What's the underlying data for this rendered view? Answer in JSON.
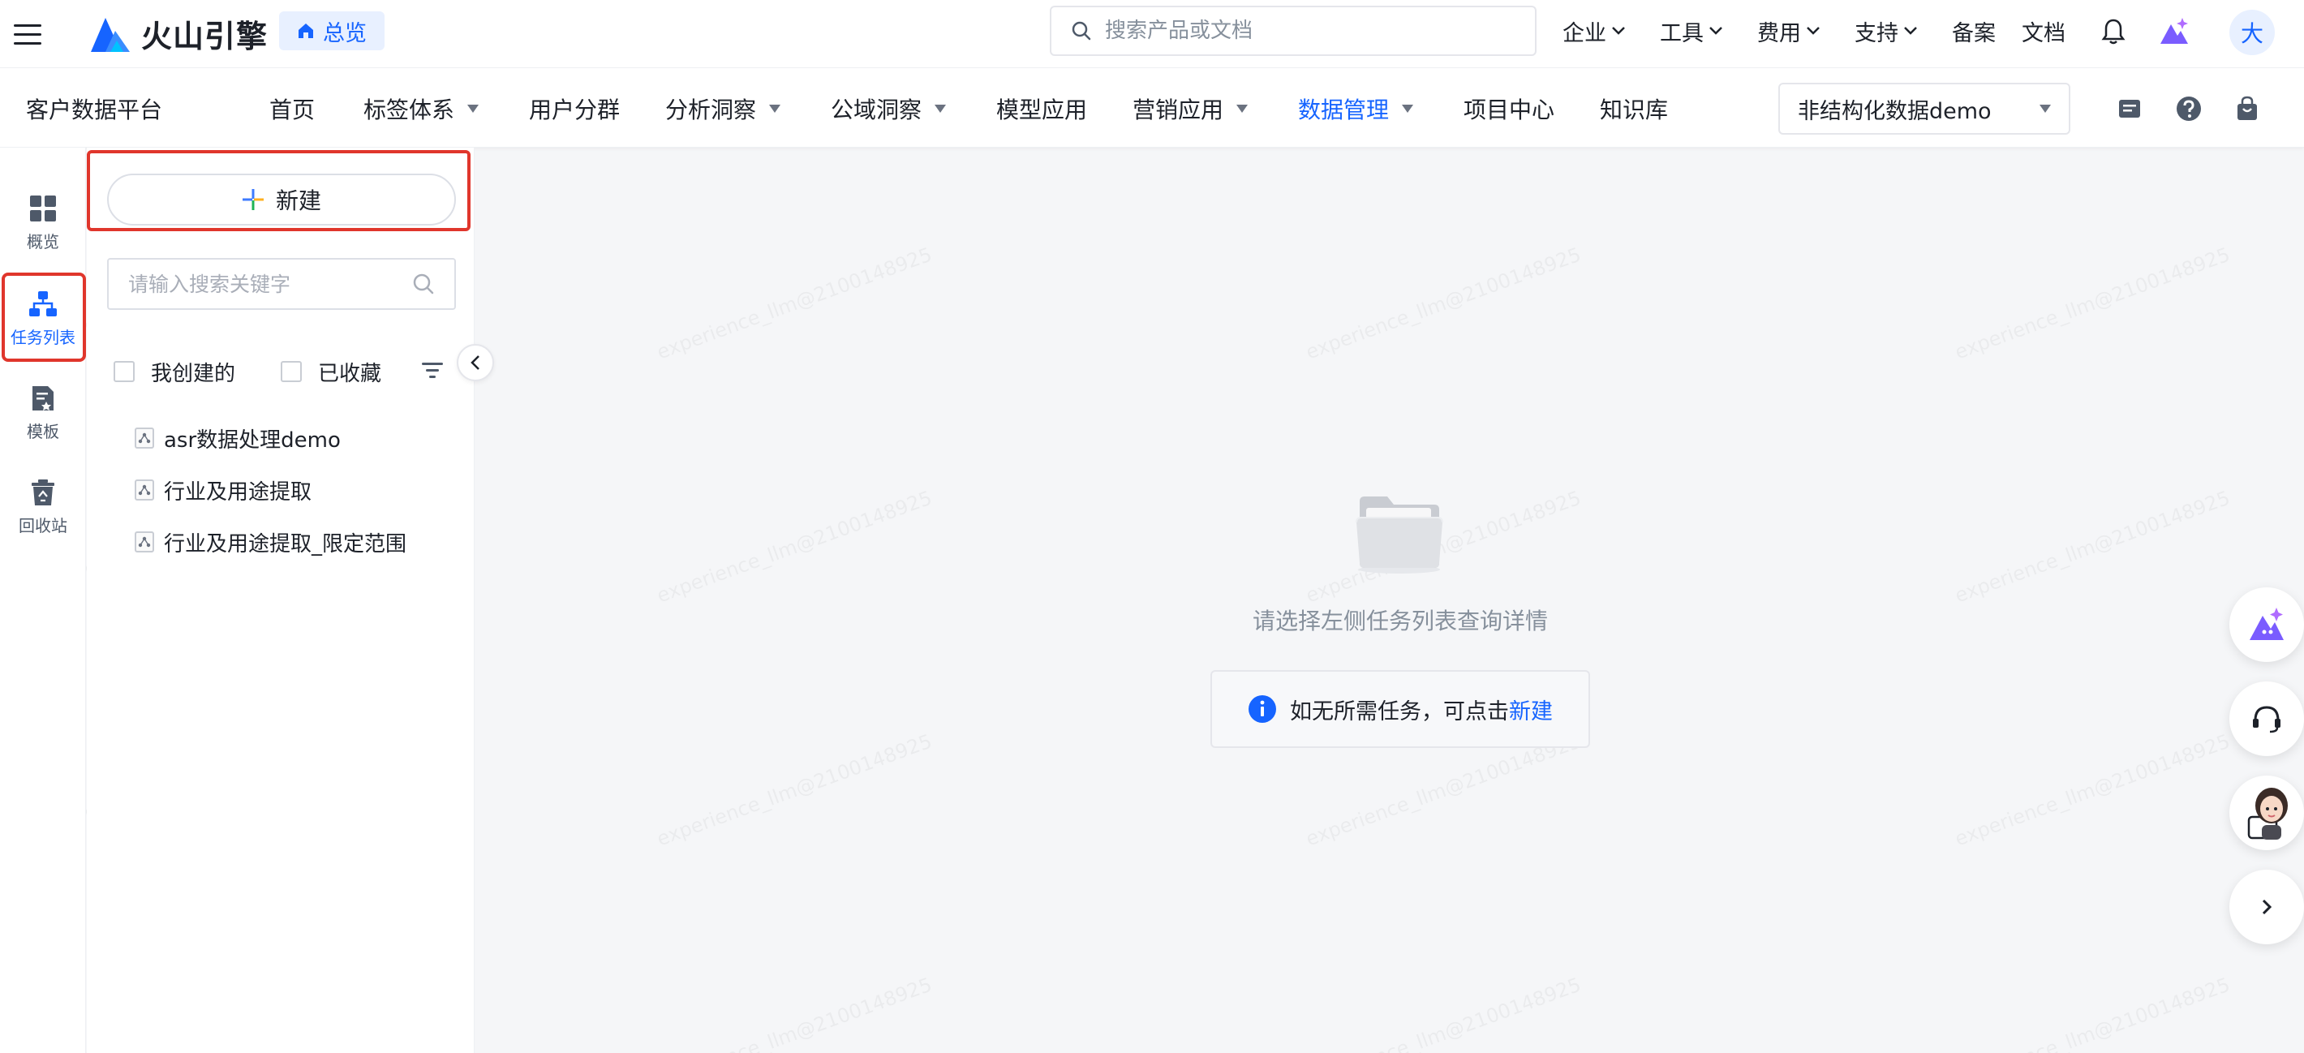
{
  "topbar": {
    "brand": "火山引擎",
    "overview_label": "总览",
    "search_placeholder": "搜索产品或文档",
    "menus": [
      {
        "label": "企业"
      },
      {
        "label": "工具"
      },
      {
        "label": "费用"
      },
      {
        "label": "支持"
      }
    ],
    "links": [
      {
        "label": "备案"
      },
      {
        "label": "文档"
      }
    ],
    "avatar_text": "大"
  },
  "subnav": {
    "platform_title": "客户数据平台",
    "items": [
      {
        "label": "首页",
        "dropdown": false
      },
      {
        "label": "标签体系",
        "dropdown": true
      },
      {
        "label": "用户分群",
        "dropdown": false
      },
      {
        "label": "分析洞察",
        "dropdown": true
      },
      {
        "label": "公域洞察",
        "dropdown": true
      },
      {
        "label": "模型应用",
        "dropdown": false
      },
      {
        "label": "营销应用",
        "dropdown": true
      },
      {
        "label": "数据管理",
        "dropdown": true,
        "active": true
      },
      {
        "label": "项目中心",
        "dropdown": false
      },
      {
        "label": "知识库",
        "dropdown": false
      }
    ],
    "project_select": "非结构化数据demo"
  },
  "rail": {
    "items": [
      {
        "label": "概览",
        "icon": "grid-icon"
      },
      {
        "label": "任务列表",
        "icon": "hierarchy-icon",
        "active": true
      },
      {
        "label": "模板",
        "icon": "template-icon"
      },
      {
        "label": "回收站",
        "icon": "recycle-icon"
      }
    ]
  },
  "panel": {
    "new_label": "新建",
    "search_placeholder": "请输入搜索关键字",
    "filters": {
      "mine": "我创建的",
      "starred": "已收藏"
    },
    "tasks": [
      {
        "label": "asr数据处理demo"
      },
      {
        "label": "行业及用途提取"
      },
      {
        "label": "行业及用途提取_限定范围"
      }
    ]
  },
  "main": {
    "empty_text": "请选择左侧任务列表查询详情",
    "hint_text": "如无所需任务，可点击",
    "hint_link": "新建"
  },
  "watermark": "experience_llm@2100148925",
  "colors": {
    "accent": "#1664ff",
    "highlight_border": "#e0362c",
    "text": "#1d2129",
    "muted": "#86909c"
  }
}
